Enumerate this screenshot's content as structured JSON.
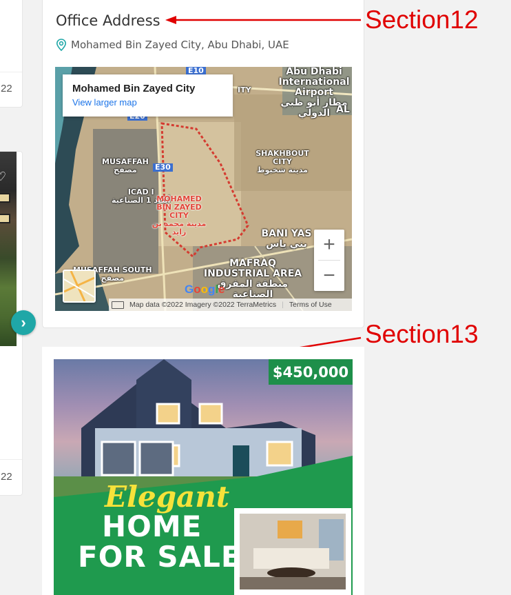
{
  "left_cards": {
    "card1_number": "22",
    "card2_number": "22"
  },
  "office": {
    "title": "Office Address",
    "address": "Mohamed Bin Zayed City, Abu Dhabi, UAE",
    "map": {
      "popup_title": "Mohamed Bin Zayed City",
      "popup_link": "View larger map",
      "zoom_in": "+",
      "zoom_out": "−",
      "footer_attribution": "Map data ©2022 Imagery ©2022 TerraMetrics",
      "footer_terms": "Terms of Use",
      "google_logo": "Google",
      "labels": {
        "airport": "Abu Dhabi International Airport",
        "airport_ar": "مطار أبو ظبي الدولي",
        "musaffah": "MUSAFFAH",
        "musaffah_ar": "مصفح",
        "icad": "ICAD I",
        "icad_ar": "أيكاد 1 الصناعية",
        "mbz": "MOHAMED BIN ZAYED CITY",
        "mbz_ar": "مدينة محمد بن زايد",
        "shakhbout": "SHAKHBOUT CITY",
        "shakhbout_ar": "مدينة شخبوط",
        "baniyas": "BANI YAS",
        "baniyas_ar": "بني ياس",
        "mafraq": "MAFRAQ INDUSTRIAL AREA",
        "mafraq_ar": "منطقة المفرق الصناعية",
        "musaffah_south": "MUSAFFAH SOUTH",
        "musaffah_south_ar": "مصفح",
        "e30": "E30",
        "e20": "E20",
        "e10": "E10",
        "ity": "ITY",
        "al": "AL"
      }
    }
  },
  "annotations": {
    "section12": "Section12",
    "section13": "Section13"
  },
  "ad": {
    "price": "$450,000",
    "line1": "Elegant",
    "line2": "HOME",
    "line3": "FOR SALE"
  },
  "colors": {
    "accent_teal": "#1fa7a7",
    "annotation_red": "#e00000",
    "ad_green": "#1e8f4a",
    "link_blue": "#1a73e8"
  }
}
